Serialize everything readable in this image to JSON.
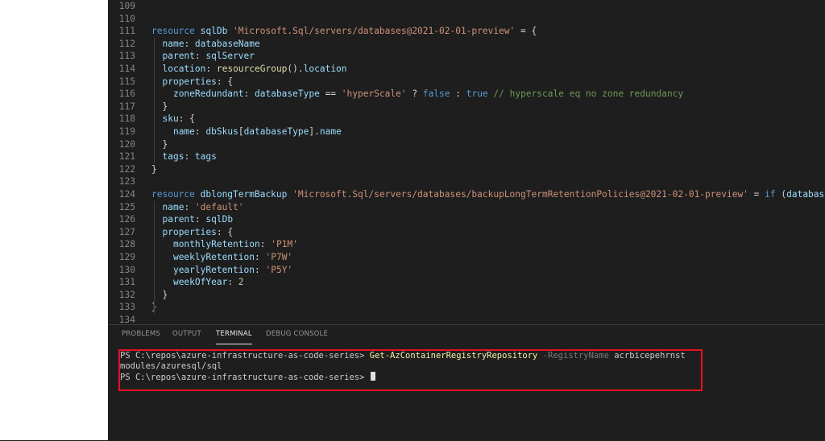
{
  "editor": {
    "lines": [
      {
        "num": "109",
        "tokens": []
      },
      {
        "num": "110",
        "tokens": []
      },
      {
        "num": "111",
        "tokens": [
          [
            "k",
            "resource "
          ],
          [
            "i",
            "sqlDb "
          ],
          [
            "s",
            "'Microsoft.Sql/servers/databases@2021-02-01-preview'"
          ],
          [
            "p",
            " = {"
          ]
        ]
      },
      {
        "num": "112",
        "tokens": [
          [
            "p",
            "  "
          ],
          [
            "i",
            "name"
          ],
          [
            "p",
            ": "
          ],
          [
            "i",
            "databaseName"
          ]
        ]
      },
      {
        "num": "113",
        "tokens": [
          [
            "p",
            "  "
          ],
          [
            "i",
            "parent"
          ],
          [
            "p",
            ": "
          ],
          [
            "i",
            "sqlServer"
          ]
        ]
      },
      {
        "num": "114",
        "tokens": [
          [
            "p",
            "  "
          ],
          [
            "i",
            "location"
          ],
          [
            "p",
            ": "
          ],
          [
            "f",
            "resourceGroup"
          ],
          [
            "p",
            "()."
          ],
          [
            "i",
            "location"
          ]
        ]
      },
      {
        "num": "115",
        "tokens": [
          [
            "p",
            "  "
          ],
          [
            "i",
            "properties"
          ],
          [
            "p",
            ": {"
          ]
        ]
      },
      {
        "num": "116",
        "tokens": [
          [
            "p",
            "    "
          ],
          [
            "i",
            "zoneRedundant"
          ],
          [
            "p",
            ": "
          ],
          [
            "i",
            "databaseType"
          ],
          [
            "p",
            " == "
          ],
          [
            "s",
            "'hyperScale'"
          ],
          [
            "p",
            " ? "
          ],
          [
            "k",
            "false"
          ],
          [
            "p",
            " : "
          ],
          [
            "k",
            "true"
          ],
          [
            "c",
            " // hyperscale eq no zone redundancy"
          ]
        ]
      },
      {
        "num": "117",
        "tokens": [
          [
            "p",
            "  }"
          ]
        ]
      },
      {
        "num": "118",
        "tokens": [
          [
            "p",
            "  "
          ],
          [
            "i",
            "sku"
          ],
          [
            "p",
            ": {"
          ]
        ]
      },
      {
        "num": "119",
        "tokens": [
          [
            "p",
            "    "
          ],
          [
            "i",
            "name"
          ],
          [
            "p",
            ": "
          ],
          [
            "i",
            "dbSkus"
          ],
          [
            "p",
            "["
          ],
          [
            "i",
            "databaseType"
          ],
          [
            "p",
            "]."
          ],
          [
            "i",
            "name"
          ]
        ]
      },
      {
        "num": "120",
        "tokens": [
          [
            "p",
            "  }"
          ]
        ]
      },
      {
        "num": "121",
        "tokens": [
          [
            "p",
            "  "
          ],
          [
            "i",
            "tags"
          ],
          [
            "p",
            ": "
          ],
          [
            "i",
            "tags"
          ]
        ]
      },
      {
        "num": "122",
        "tokens": [
          [
            "p",
            "}"
          ]
        ]
      },
      {
        "num": "123",
        "tokens": []
      },
      {
        "num": "124",
        "tokens": [
          [
            "k",
            "resource "
          ],
          [
            "i",
            "dblongTermBackup "
          ],
          [
            "s",
            "'Microsoft.Sql/servers/databases/backupLongTermRetentionPolicies@2021-02-01-preview'"
          ],
          [
            "p",
            " = "
          ],
          [
            "k",
            "if"
          ],
          [
            "p",
            " ("
          ],
          [
            "i",
            "databaseType"
          ],
          [
            "p",
            " !="
          ]
        ]
      },
      {
        "num": "125",
        "tokens": [
          [
            "p",
            "  "
          ],
          [
            "i",
            "name"
          ],
          [
            "p",
            ": "
          ],
          [
            "s",
            "'default'"
          ]
        ]
      },
      {
        "num": "126",
        "tokens": [
          [
            "p",
            "  "
          ],
          [
            "i",
            "parent"
          ],
          [
            "p",
            ": "
          ],
          [
            "i",
            "sqlDb"
          ]
        ]
      },
      {
        "num": "127",
        "tokens": [
          [
            "p",
            "  "
          ],
          [
            "i",
            "properties"
          ],
          [
            "p",
            ": {"
          ]
        ]
      },
      {
        "num": "128",
        "tokens": [
          [
            "p",
            "    "
          ],
          [
            "i",
            "monthlyRetention"
          ],
          [
            "p",
            ": "
          ],
          [
            "s",
            "'P1M'"
          ]
        ]
      },
      {
        "num": "129",
        "tokens": [
          [
            "p",
            "    "
          ],
          [
            "i",
            "weeklyRetention"
          ],
          [
            "p",
            ": "
          ],
          [
            "s",
            "'P7W'"
          ]
        ]
      },
      {
        "num": "130",
        "tokens": [
          [
            "p",
            "    "
          ],
          [
            "i",
            "yearlyRetention"
          ],
          [
            "p",
            ": "
          ],
          [
            "s",
            "'P5Y'"
          ]
        ]
      },
      {
        "num": "131",
        "tokens": [
          [
            "p",
            "    "
          ],
          [
            "i",
            "weekOfYear"
          ],
          [
            "p",
            ": "
          ],
          [
            "n",
            "2"
          ]
        ]
      },
      {
        "num": "132",
        "tokens": [
          [
            "p",
            "  }"
          ]
        ]
      },
      {
        "num": "133",
        "tokens": [
          [
            "p",
            "}"
          ]
        ]
      },
      {
        "num": "134",
        "tokens": []
      }
    ]
  },
  "panel": {
    "tabs": [
      "PROBLEMS",
      "OUTPUT",
      "TERMINAL",
      "DEBUG CONSOLE"
    ],
    "active_tab": "TERMINAL"
  },
  "terminal": {
    "prompt": "PS C:\\repos\\azure-infrastructure-as-code-series> ",
    "command": "Get-AzContainerRegistryRepository",
    "param_name": " -RegistryName",
    "param_value": " acrbicepehrnst",
    "output": "modules/azuresql/sql",
    "prompt2": "PS C:\\repos\\azure-infrastructure-as-code-series> "
  }
}
